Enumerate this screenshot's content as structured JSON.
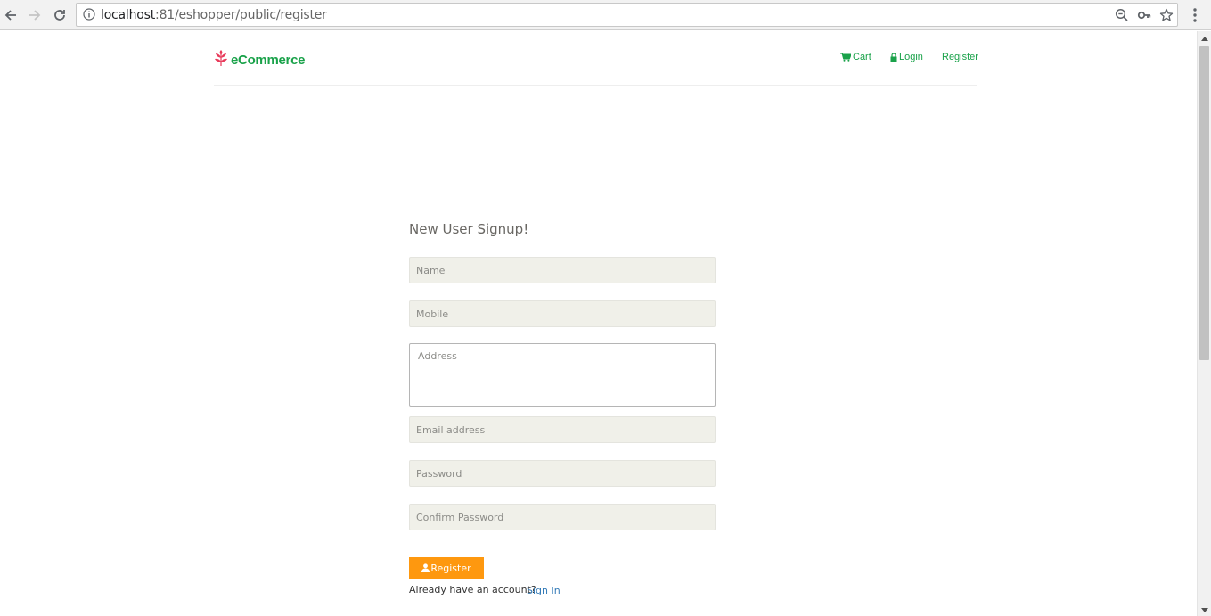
{
  "browser": {
    "url_host": "localhost",
    "url_path": ":81/eshopper/public/register",
    "icons": [
      "back-arrow-icon",
      "forward-arrow-icon",
      "reload-icon",
      "info-icon",
      "zoom-icon",
      "key-icon",
      "star-icon",
      "menu-dots-icon"
    ]
  },
  "header": {
    "logo_text": "eCommerce",
    "logo_icon": "leaf-icon",
    "nav": {
      "cart": "Cart",
      "login": "Login",
      "register": "Register"
    }
  },
  "signup": {
    "title": "New User Signup!",
    "name_placeholder": "Name",
    "mobile_placeholder": "Mobile",
    "address_placeholder": "Address",
    "email_placeholder": "Email address",
    "password_placeholder": "Password",
    "confirm_password_placeholder": "Confirm Password",
    "register_button": "Register",
    "already_text": "Already have an account?",
    "signin_link": "Sign In"
  },
  "colors": {
    "brand_green": "#1aa24a",
    "button_orange": "#fe980f",
    "logo_red": "#e83a5a",
    "link_blue": "#337ab7"
  }
}
